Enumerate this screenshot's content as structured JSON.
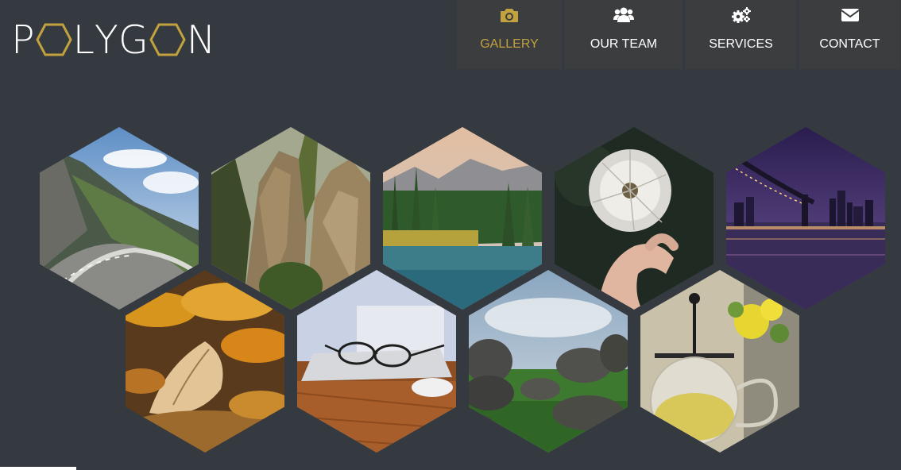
{
  "brand": {
    "letters": [
      "P",
      "L",
      "Y",
      "G",
      "N"
    ],
    "hex_color": "#c2a23e",
    "text_color": "#ffffff"
  },
  "nav": {
    "items": [
      {
        "label": "GALLERY",
        "icon": "camera-icon",
        "active": true
      },
      {
        "label": "OUR TEAM",
        "icon": "users-icon",
        "active": false
      },
      {
        "label": "SERVICES",
        "icon": "gears-icon",
        "active": false
      },
      {
        "label": "CONTACT",
        "icon": "envelope-icon",
        "active": false
      }
    ],
    "active_color": "#c2a23e",
    "bg_color": "#3c3d3f"
  },
  "gallery": {
    "tiles": [
      {
        "subject": "mountain road"
      },
      {
        "subject": "sandstone rocks"
      },
      {
        "subject": "mountain lake"
      },
      {
        "subject": "dandelion"
      },
      {
        "subject": "bridge at night"
      },
      {
        "subject": "autumn leaves"
      },
      {
        "subject": "glasses on laptop"
      },
      {
        "subject": "stones on grass"
      },
      {
        "subject": "tea pot"
      }
    ]
  },
  "colors": {
    "background": "#353a40"
  }
}
